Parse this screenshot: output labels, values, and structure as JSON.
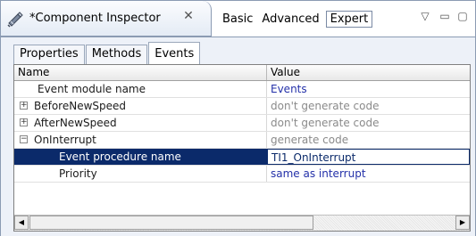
{
  "view": {
    "title": "*Component Inspector",
    "close_glyph": "✕",
    "icon": "component-inspector-icon"
  },
  "levels": [
    {
      "label": "Basic",
      "active": false
    },
    {
      "label": "Advanced",
      "active": false
    },
    {
      "label": "Expert",
      "active": true
    }
  ],
  "window_controls": {
    "menu_glyph": "▽",
    "minimize_glyph": "▭",
    "maximize_glyph": "▢"
  },
  "subtabs": [
    {
      "label": "Properties",
      "active": false
    },
    {
      "label": "Methods",
      "active": false
    },
    {
      "label": "Events",
      "active": true
    }
  ],
  "grid": {
    "columns": [
      "Name",
      "Value"
    ],
    "rows": [
      {
        "name": "Event module name",
        "value": "Events",
        "expander": "",
        "indent": 1,
        "value_style": "default"
      },
      {
        "name": "BeforeNewSpeed",
        "value": "don't generate code",
        "expander": "+",
        "indent": 0,
        "value_style": "muted"
      },
      {
        "name": "AfterNewSpeed",
        "value": "don't generate code",
        "expander": "+",
        "indent": 0,
        "value_style": "muted"
      },
      {
        "name": "OnInterrupt",
        "value": "generate code",
        "expander": "−",
        "indent": 0,
        "value_style": "muted"
      },
      {
        "name": "Event procedure name",
        "value": "TI1_OnInterrupt",
        "expander": "",
        "indent": 2,
        "value_style": "default",
        "selected": true
      },
      {
        "name": "Priority",
        "value": "same as interrupt",
        "expander": "",
        "indent": 2,
        "value_style": "default"
      }
    ]
  },
  "scrollbar": {
    "left_glyph": "◀",
    "right_glyph": "▶"
  },
  "colors": {
    "selection": "#0b2a6a",
    "value_text": "#2431a9",
    "muted_text": "#8a8a8a",
    "panel_bg": "#edf1f8"
  }
}
